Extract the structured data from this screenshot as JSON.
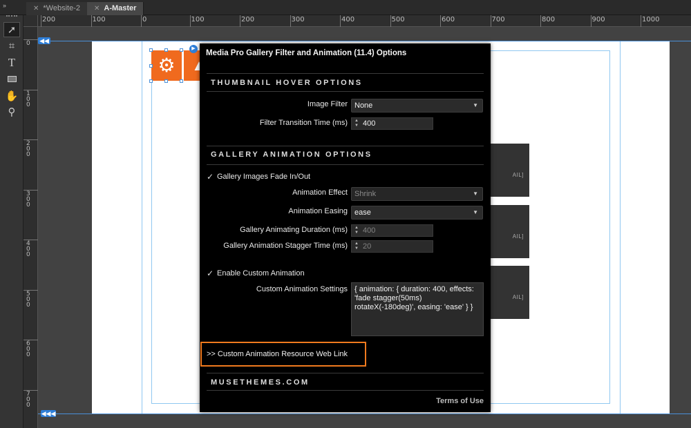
{
  "tabs": [
    {
      "label": "*Website-2",
      "active": false
    },
    {
      "label": "A-Master",
      "active": true
    }
  ],
  "tools": [
    "selection-arrow-icon",
    "crop-icon",
    "text-icon",
    "rectangle-icon",
    "hand-icon",
    "zoom-icon"
  ],
  "ruler": {
    "horizontal": [
      "200",
      "100",
      "0",
      "100",
      "200",
      "300",
      "400",
      "500",
      "600",
      "700",
      "800",
      "900",
      "1000"
    ],
    "vertical": [
      "0",
      "100",
      "200",
      "300",
      "400",
      "500",
      "600",
      "700"
    ]
  },
  "canvas": {
    "thumb_label": "AIL]"
  },
  "dialog": {
    "title": "Media Pro Gallery Filter and Animation (11.4) Options",
    "thumbnail_section": "THUMBNAIL HOVER OPTIONS",
    "image_filter_label": "Image Filter",
    "image_filter_value": "None",
    "filter_transition_label": "Filter Transition Time (ms)",
    "filter_transition_value": "400",
    "gallery_section": "GALLERY ANIMATION OPTIONS",
    "fade_checkbox_label": "Gallery Images Fade In/Out",
    "animation_effect_label": "Animation Effect",
    "animation_effect_value": "Shrink",
    "animation_easing_label": "Animation Easing",
    "animation_easing_value": "ease",
    "duration_label": "Gallery Animating Duration (ms)",
    "duration_value": "400",
    "stagger_label": "Gallery Animation Stagger Time (ms)",
    "stagger_value": "20",
    "custom_checkbox_label": "Enable Custom Animation",
    "custom_settings_label": "Custom Animation Settings",
    "custom_settings_value": "{ animation: { duration: 400, effects: 'fade stagger(50ms) rotateX(-180deg)', easing: 'ease' } }",
    "web_link": ">> Custom Animation Resource Web Link",
    "brand": "MUSETHEMES.COM",
    "terms": "Terms of Use"
  },
  "colors": {
    "accent_orange": "#f06a1e",
    "guide_blue": "#2f7fd8"
  }
}
